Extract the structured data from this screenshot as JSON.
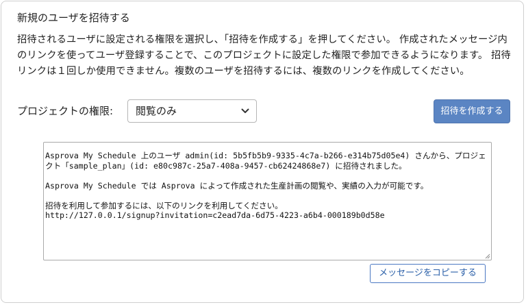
{
  "dialog": {
    "title": "新規のユーザを招待する",
    "description": "招待されるユーザに設定される権限を選択し、「招待を作成する」を押してください。 作成されたメッセージ内のリンクを使ってユーザ登録することで、このプロジェクトに設定した権限で参加できるようになります。 招待リンクは１回しか使用できません。複数のユーザを招待するには、複数のリンクを作成してください。",
    "permission_label": "プロジェクトの権限:",
    "permission_select": {
      "selected": "閲覧のみ"
    },
    "create_button_label": "招待を作成する",
    "message": "Asprova My Schedule 上のユーザ admin(id: 5b5fb5b9-9335-4c7a-b266-e314b75d05e4) さんから、プロジェクト「sample_plan」(id: e80c987c-25a7-408a-9457-cb62424868e7) に招待されました。\n\nAsprova My Schedule では Asprova によって作成された生産計画の閲覧や、実績の入力が可能です。\n\n招待を利用して参加するには、以下のリンクを利用してください。\nhttp://127.0.0.1/signup?invitation=c2ead7da-6d75-4223-a6b4-000189b0d58e",
    "copy_button_label": "メッセージをコピーする"
  },
  "colors": {
    "primary": "#2e63b3",
    "border": "#cfcfcf",
    "link_text": "#2a5fa8"
  },
  "icons": {
    "select_chevron": "chevron-down-icon",
    "textarea_grip": "resize-grip-icon"
  }
}
